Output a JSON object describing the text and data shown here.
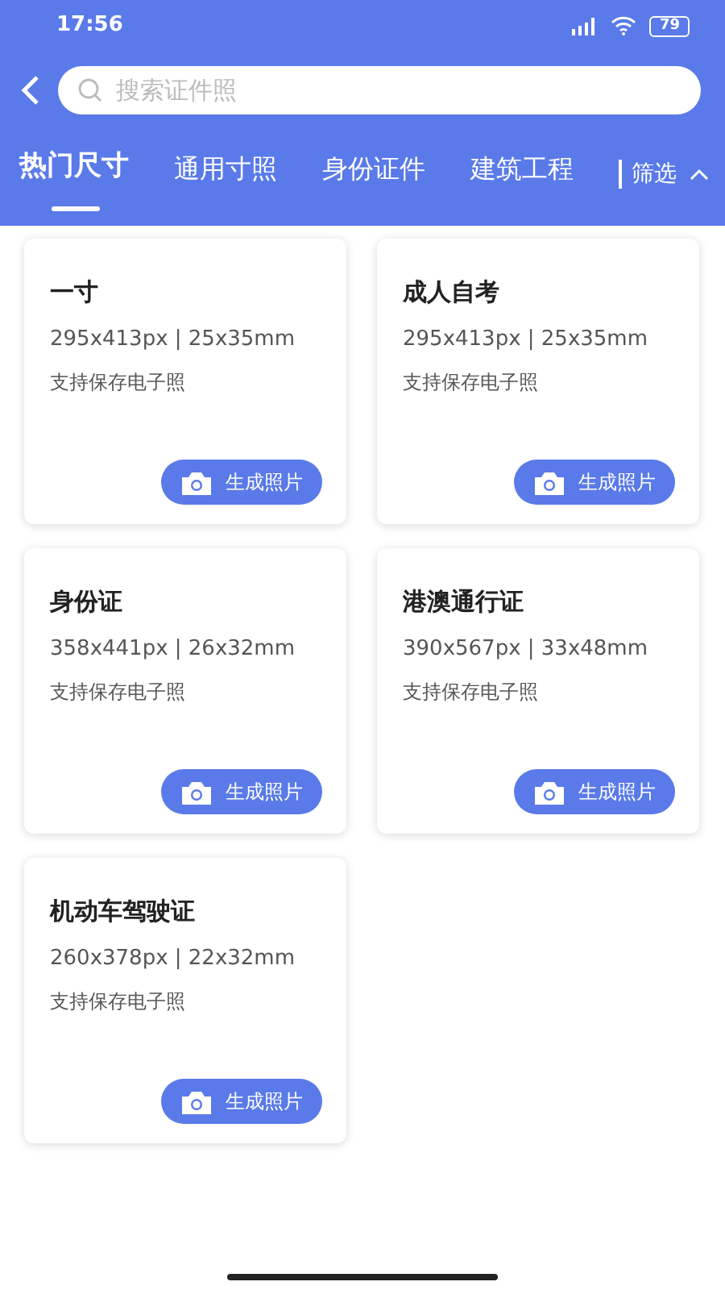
{
  "status_bar": {
    "time": "17:56",
    "battery": "79"
  },
  "search": {
    "placeholder": "搜索证件照"
  },
  "tabs": [
    {
      "label": "热门尺寸",
      "selected": true
    },
    {
      "label": "通用寸照",
      "selected": false
    },
    {
      "label": "身份证件",
      "selected": false
    },
    {
      "label": "建筑工程",
      "selected": false
    }
  ],
  "filter": {
    "label": "筛选",
    "expanded": true
  },
  "cards": [
    {
      "title": "一寸",
      "size": "295x413px | 25x35mm",
      "note": "支持保存电子照",
      "button": "生成照片"
    },
    {
      "title": "成人自考",
      "size": "295x413px | 25x35mm",
      "note": "支持保存电子照",
      "button": "生成照片"
    },
    {
      "title": "身份证",
      "size": "358x441px | 26x32mm",
      "note": "支持保存电子照",
      "button": "生成照片"
    },
    {
      "title": "港澳通行证",
      "size": "390x567px | 33x48mm",
      "note": "支持保存电子照",
      "button": "生成照片"
    },
    {
      "title": "机动车驾驶证",
      "size": "260x378px | 22x32mm",
      "note": "支持保存电子照",
      "button": "生成照片"
    }
  ]
}
